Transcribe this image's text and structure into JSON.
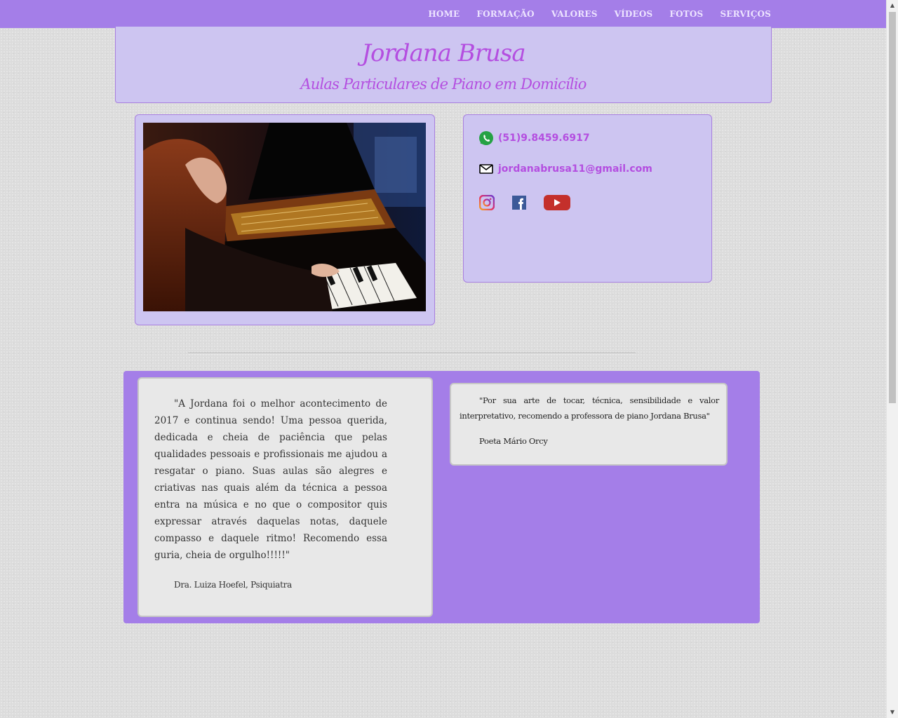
{
  "nav": {
    "items": [
      "HOME",
      "FORMAÇÃO",
      "VALORES",
      "VÍDEOS",
      "FOTOS",
      "SERVIÇOS"
    ]
  },
  "header": {
    "title": "Jordana Brusa",
    "subtitle": "Aulas Particulares de Piano em Domicílio"
  },
  "contact": {
    "phone": "(51)9.8459.6917",
    "email": "jordanabrusa11@gmail.com",
    "social": [
      "instagram-icon",
      "facebook-icon",
      "youtube-icon"
    ]
  },
  "testimonials": [
    {
      "quote": "\"A Jordana foi o melhor acontecimento de 2017 e continua sendo! Uma pessoa querida, dedicada e cheia de paciência que pelas qualidades pessoais e profissionais me ajudou a resgatar o piano. Suas aulas são alegres e criativas nas quais além da técnica a pessoa entra na música e no que o compositor quis expressar através daquelas notas, daquele compasso e daquele ritmo! Recomendo essa guria, cheia de orgulho!!!!!\"",
      "author": "Dra. Luiza Hoefel, Psiquiatra"
    },
    {
      "quote": "\"Por sua arte de tocar, técnica, sensibilidade e valor interpretativo, recomendo a professora de piano Jordana Brusa\"",
      "author": "Poeta Mário Orcy"
    }
  ],
  "colors": {
    "nav_bg": "#a47ee8",
    "panel_bg": "#cdc5f1",
    "accent": "#b44ee0"
  }
}
